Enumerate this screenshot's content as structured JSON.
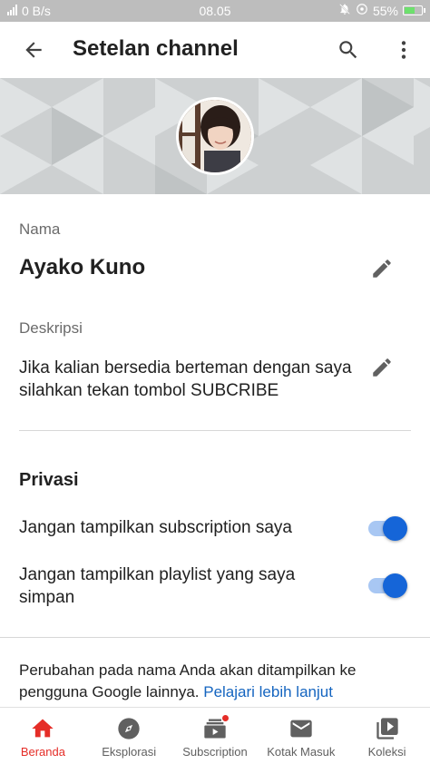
{
  "status_bar": {
    "data_speed": "0 B/s",
    "time": "08.05",
    "battery": "55%",
    "battery_level": 0.55
  },
  "app_bar": {
    "title": "Setelan channel",
    "back_icon": "arrow-back-icon",
    "search_icon": "search-icon",
    "more_icon": "more-vert-icon"
  },
  "channel": {
    "name_label": "Nama",
    "name_value": "Ayako Kuno",
    "description_label": "Deskripsi",
    "description_value": "Jika kalian bersedia berteman dengan saya silahkan tekan tombol SUBCRIBE"
  },
  "privacy": {
    "title": "Privasi",
    "settings": [
      {
        "label": "Jangan tampilkan subscription saya",
        "enabled": true
      },
      {
        "label": "Jangan tampilkan playlist yang saya simpan",
        "enabled": true
      }
    ]
  },
  "footer": {
    "note": "Perubahan pada nama Anda akan ditampilkan ke pengguna Google lainnya.",
    "link": "Pelajari lebih lanjut"
  },
  "bottom_nav": [
    {
      "label": "Beranda",
      "icon": "home-icon",
      "active": true
    },
    {
      "label": "Eksplorasi",
      "icon": "explore-icon",
      "active": false
    },
    {
      "label": "Subscription",
      "icon": "subscriptions-icon",
      "active": false,
      "badge": true
    },
    {
      "label": "Kotak Masuk",
      "icon": "mail-icon",
      "active": false
    },
    {
      "label": "Koleksi",
      "icon": "library-icon",
      "active": false
    }
  ],
  "colors": {
    "accent_blue": "#1565d8",
    "active_red": "#e52d27",
    "link_blue": "#1565c0"
  }
}
